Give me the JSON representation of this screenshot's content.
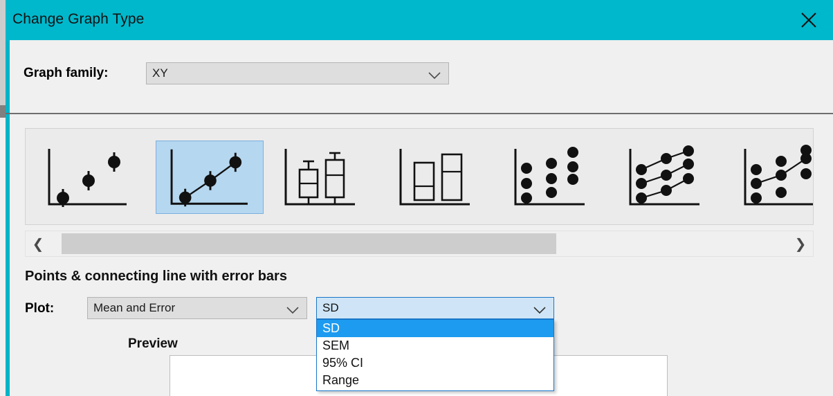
{
  "window": {
    "title": "Change Graph Type",
    "close_icon": "close-icon",
    "accent_color": "#00b8cc"
  },
  "graph_family": {
    "label": "Graph family:",
    "value": "XY",
    "chevron_icon": "chevron-down-icon"
  },
  "gallery": {
    "items": [
      {
        "name": "points-with-error-bars",
        "selected": false
      },
      {
        "name": "points-connecting-line-with-error-bars",
        "selected": true
      },
      {
        "name": "box-and-whiskers",
        "selected": false
      },
      {
        "name": "floating-bars",
        "selected": false
      },
      {
        "name": "scatter-dot-plot",
        "selected": false
      },
      {
        "name": "before-after-connected-points",
        "selected": false
      },
      {
        "name": "scatter-with-connecting-line",
        "selected": false
      }
    ],
    "scroll_left_icon": "chevron-left-icon",
    "scroll_right_icon": "chevron-right-icon"
  },
  "graph_type_name": "Points & connecting line with error bars",
  "plot": {
    "label": "Plot:",
    "value": "Mean and Error",
    "chevron_icon": "chevron-down-icon"
  },
  "error_type": {
    "value": "SD",
    "chevron_icon": "chevron-down-icon",
    "expanded": true,
    "options": [
      {
        "label": "SD",
        "selected": true
      },
      {
        "label": "SEM",
        "selected": false
      },
      {
        "label": "95% CI",
        "selected": false
      },
      {
        "label": "Range",
        "selected": false
      }
    ]
  },
  "preview": {
    "label": "Preview"
  }
}
